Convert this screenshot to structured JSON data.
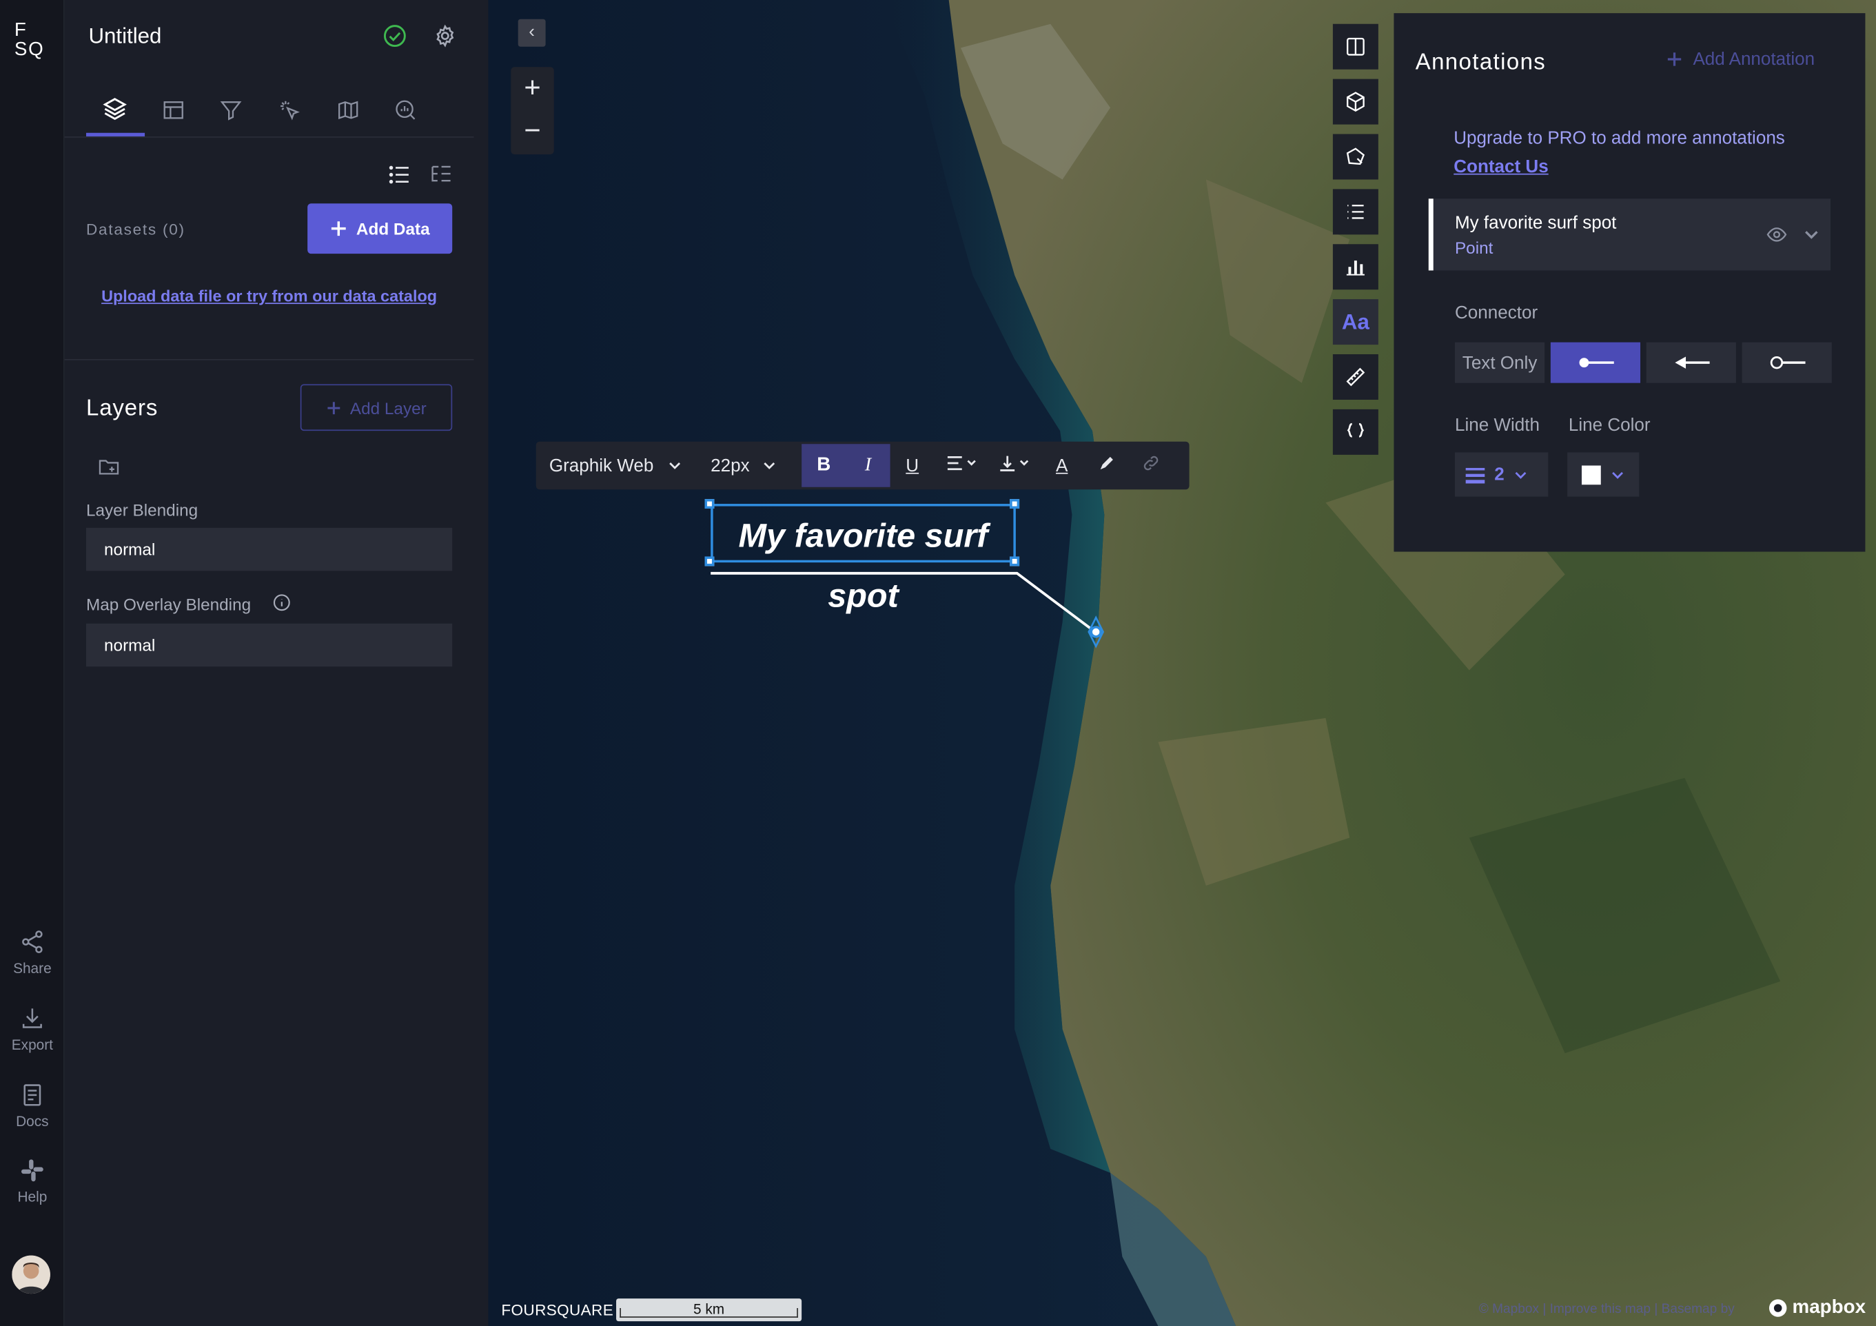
{
  "rail": {
    "logo_line1": "F",
    "logo_line2": "SQ",
    "items": [
      {
        "label": "Share",
        "icon": "share-icon"
      },
      {
        "label": "Export",
        "icon": "download-icon"
      },
      {
        "label": "Docs",
        "icon": "book-icon"
      },
      {
        "label": "Help",
        "icon": "slack-icon"
      }
    ]
  },
  "panel": {
    "title": "Untitled",
    "tabs": [
      "layers-icon",
      "table-icon",
      "filter-icon",
      "interaction-icon",
      "basemap-icon",
      "search-analytics-icon"
    ],
    "datasets_label": "Datasets (0)",
    "add_data": "Add Data",
    "upload_link": "Upload data file or try from our data catalog",
    "layers_title": "Layers",
    "add_layer": "Add Layer",
    "layer_blending_label": "Layer Blending",
    "layer_blending_value": "normal",
    "overlay_blending_label": "Map Overlay Blending",
    "overlay_blending_value": "normal"
  },
  "text_toolbar": {
    "font": "Graphik Web",
    "size": "22px",
    "bold": "B",
    "italic": "I",
    "underline": "U",
    "text_color": "A"
  },
  "annotation_text": "My favorite surf spot",
  "annotations_panel": {
    "title": "Annotations",
    "add_annotation": "Add Annotation",
    "upgrade_text": "Upgrade to PRO to add more annotations",
    "contact": "Contact Us",
    "card_title": "My favorite surf spot",
    "card_type": "Point",
    "connector_label": "Connector",
    "connector_text_only": "Text Only",
    "line_width_label": "Line Width",
    "line_width_value": "2",
    "line_color_label": "Line Color",
    "line_color": "#ffffff"
  },
  "map_toolbar": {
    "text_button": "Aa"
  },
  "footer": {
    "brand": "FOURSQUARE",
    "scale": "5 km",
    "attribution": "© Mapbox | Improve this map | Basemap by",
    "mapbox": "mapbox"
  },
  "colors": {
    "accent": "#5b5bd6",
    "link": "#7b7cf0",
    "success": "#3fb950",
    "selection": "#2f8de0"
  }
}
